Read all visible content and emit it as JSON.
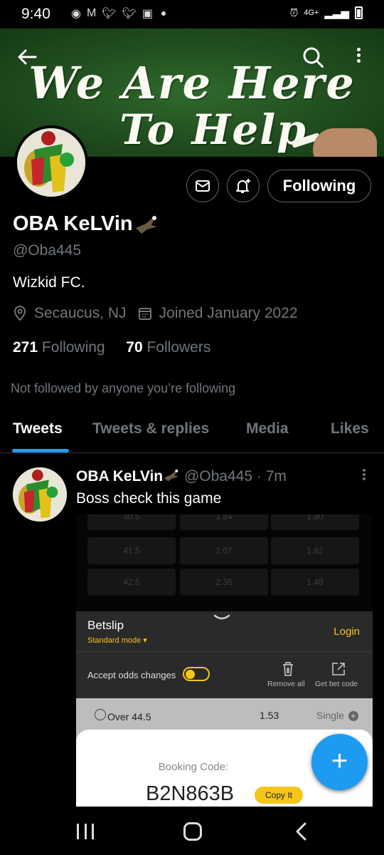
{
  "status_bar": {
    "time": "9:40",
    "network": "4G+"
  },
  "header": {
    "banner_line1": "We Are Here",
    "banner_line2": "To Help",
    "back_icon": "arrow-left-icon",
    "search_icon": "search-icon",
    "more_icon": "more-vertical-icon"
  },
  "profile": {
    "name": "OBA KeLVin",
    "handle": "@Oba445",
    "bio": "Wizkid FC.",
    "location": "Secaucus, NJ",
    "joined": "Joined January 2022",
    "following_count": "271",
    "following_label": "Following",
    "followers_count": "70",
    "followers_label": "Followers",
    "not_followed": "Not followed by anyone you’re following",
    "follow_button": "Following"
  },
  "tabs": [
    {
      "label": "Tweets",
      "active": true
    },
    {
      "label": "Tweets & replies",
      "active": false
    },
    {
      "label": "Media",
      "active": false
    },
    {
      "label": "Likes",
      "active": false
    }
  ],
  "tweet": {
    "name": "OBA KeLVin",
    "handle": "@Oba445",
    "separator": "·",
    "time": "7m",
    "text": "Boss check this game"
  },
  "media": {
    "odds_rows": [
      [
        "40.5",
        "1.84",
        "1.80"
      ],
      [
        "41.5",
        "2.07",
        "1.62"
      ],
      [
        "42.5",
        "2.36",
        "1.48"
      ]
    ],
    "betslip": {
      "title": "Betslip",
      "mode": "Standard mode ▾",
      "login": "Login",
      "accept_odds": "Accept odds changes",
      "remove_all": "Remove all",
      "get_bet_code": "Get bet code",
      "selection": "Over 44.5",
      "odds": "1.53",
      "bet_type": "Single"
    },
    "booking": {
      "label": "Booking Code:",
      "code": "B2N863B",
      "copy_label": "Copy It"
    }
  },
  "fab": {
    "label": "+"
  },
  "colors": {
    "accent": "#1d9bf0",
    "background": "#000000",
    "muted_text": "#71767b",
    "bet_yellow": "#f5c518"
  }
}
